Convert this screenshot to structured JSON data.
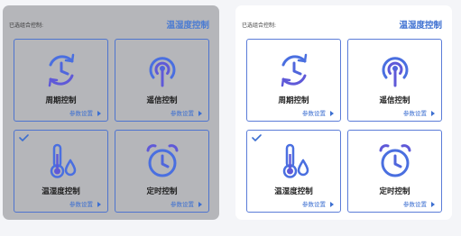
{
  "panels": [
    {
      "title": "已选组合控制:",
      "mode": "温湿度控制",
      "state": "pressed",
      "cards": [
        {
          "label": "周期控制",
          "icon": "cycle-clock-icon",
          "param": "参数设置",
          "checked": false
        },
        {
          "label": "遥信控制",
          "icon": "signal-broadcast-icon",
          "param": "参数设置",
          "checked": false
        },
        {
          "label": "温湿度控制",
          "icon": "thermometer-drop-icon",
          "param": "参数设置",
          "checked": true
        },
        {
          "label": "定时控制",
          "icon": "alarm-clock-icon",
          "param": "参数设置",
          "checked": false
        }
      ]
    },
    {
      "title": "已选组合控制:",
      "mode": "温湿度控制",
      "state": "normal",
      "cards": [
        {
          "label": "周期控制",
          "icon": "cycle-clock-icon",
          "param": "参数设置",
          "checked": false
        },
        {
          "label": "遥信控制",
          "icon": "signal-broadcast-icon",
          "param": "参数设置",
          "checked": false
        },
        {
          "label": "温湿度控制",
          "icon": "thermometer-drop-icon",
          "param": "参数设置",
          "checked": true
        },
        {
          "label": "定时控制",
          "icon": "alarm-clock-icon",
          "param": "参数设置",
          "checked": false
        }
      ]
    }
  ],
  "colors": {
    "accent": "#3c6fd1",
    "icon_blue": "#4a6fe0",
    "icon_purple": "#5f59d8",
    "pressed_bg": "#b5b6ba"
  }
}
